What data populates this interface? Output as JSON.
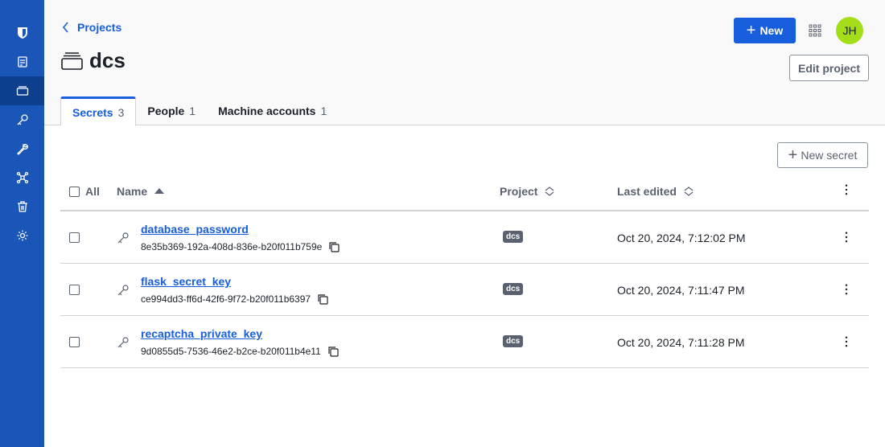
{
  "sidebar": {
    "items": [
      {
        "name": "shield-icon"
      },
      {
        "name": "projects-list-icon"
      },
      {
        "name": "projects-icon",
        "active": true
      },
      {
        "name": "key-icon"
      },
      {
        "name": "wrench-icon"
      },
      {
        "name": "integrations-icon"
      },
      {
        "name": "trash-icon"
      },
      {
        "name": "gear-icon"
      }
    ]
  },
  "header": {
    "breadcrumb": "Projects",
    "title": "dcs",
    "new_button": "New",
    "avatar_initials": "JH",
    "edit_button": "Edit project",
    "tabs": [
      {
        "label": "Secrets",
        "count": "3",
        "active": true
      },
      {
        "label": "People",
        "count": "1"
      },
      {
        "label": "Machine accounts",
        "count": "1"
      }
    ]
  },
  "main": {
    "new_secret_button": "New secret",
    "columns": {
      "all": "All",
      "name": "Name",
      "project": "Project",
      "last_edited": "Last edited"
    },
    "rows": [
      {
        "name": "database_password",
        "id": "8e35b369-192a-408d-836e-b20f011b759e",
        "project": "dcs",
        "last_edited": "Oct 20, 2024, 7:12:02 PM"
      },
      {
        "name": "flask_secret_key",
        "id": "ce994dd3-ff6d-42f6-9f72-b20f011b6397",
        "project": "dcs",
        "last_edited": "Oct 20, 2024, 7:11:47 PM"
      },
      {
        "name": "recaptcha_private_key",
        "id": "9d0855d5-7536-46e2-b2ce-b20f011b4e11",
        "project": "dcs",
        "last_edited": "Oct 20, 2024, 7:11:28 PM"
      }
    ]
  },
  "colors": {
    "accent": "#175ddc",
    "sidebar": "#1a56b8",
    "avatar": "#a4dd1a",
    "badge": "#5a6170"
  }
}
